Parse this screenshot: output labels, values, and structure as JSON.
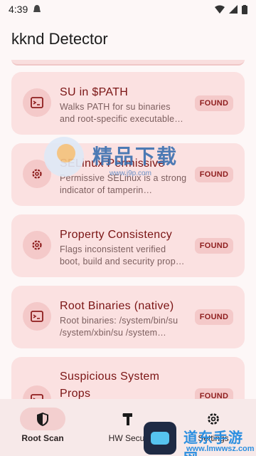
{
  "status_bar": {
    "time": "4:39"
  },
  "app": {
    "title": "kknd Detector"
  },
  "checks": [
    {
      "title": "SU in $PATH",
      "description": "Walks PATH for su binaries and root-specific executable…",
      "status": "FOUND",
      "icon": "terminal-icon"
    },
    {
      "title": "SELinux Permissive",
      "description": "Permissive SELinux is a strong indicator of tamperin…",
      "status": "FOUND",
      "icon": "gear-icon"
    },
    {
      "title": "Property Consistency",
      "description": "Flags inconsistent verified boot, build and security prop…",
      "status": "FOUND",
      "icon": "gear-icon"
    },
    {
      "title": "Root Binaries (native)",
      "description": "Root binaries: /system/bin/su /system/xbin/su /system…",
      "status": "FOUND",
      "icon": "terminal-icon"
    },
    {
      "title": "Suspicious System Props",
      "description": "",
      "status": "FOUND",
      "icon": "terminal-icon"
    }
  ],
  "nav": {
    "items": [
      {
        "label": "Root Scan",
        "icon": "shield-icon",
        "active": true
      },
      {
        "label": "HW Secur",
        "icon": "hammer-icon",
        "active": false
      },
      {
        "label": "Settings",
        "icon": "gear-icon",
        "active": false
      }
    ]
  },
  "watermark": {
    "text": "精品下载",
    "sub": "www.j9p.com"
  },
  "corner_watermark": {
    "text": "道东手游网",
    "url": "www.lmwwsz.com"
  },
  "colors": {
    "accent": "#7a1414",
    "card_bg": "#fbe1e1",
    "badge_bg": "#f4c9c9",
    "nav_bg": "#f7e9e9"
  }
}
